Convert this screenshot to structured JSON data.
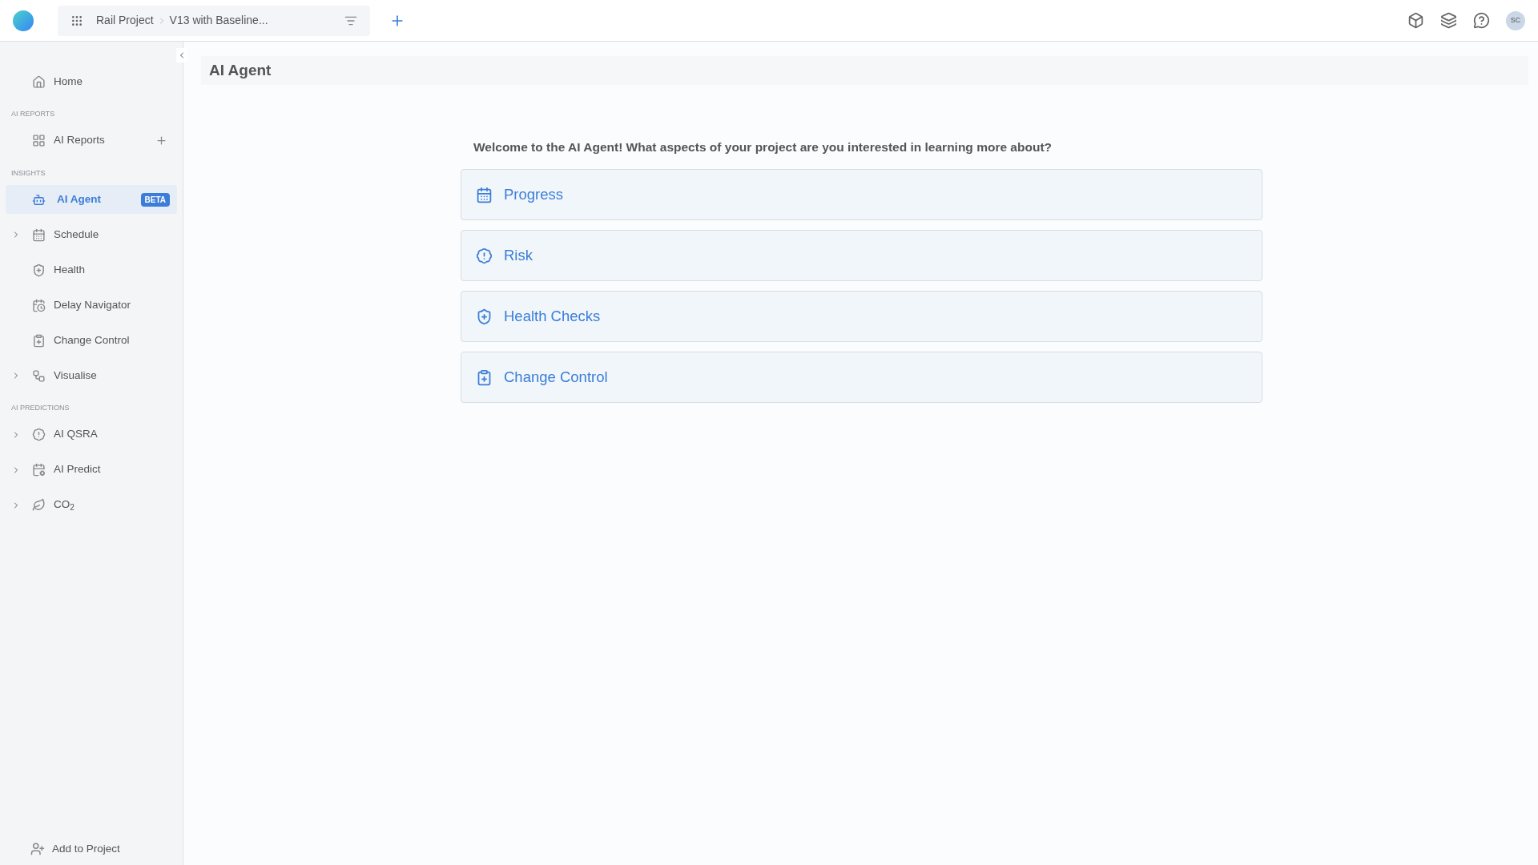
{
  "topbar": {
    "breadcrumb": [
      "Rail Project",
      "V13 with Baseline..."
    ],
    "avatar": "SC"
  },
  "sidebar": {
    "sections": [
      {
        "items": [
          {
            "label": "Home",
            "expandable": false,
            "selected": false
          }
        ]
      },
      {
        "heading": "AI REPORTS",
        "items": [
          {
            "label": "AI Reports",
            "expandable": false,
            "selected": false,
            "addable": true
          }
        ]
      },
      {
        "heading": "INSIGHTS",
        "items": [
          {
            "label": "AI Agent",
            "expandable": false,
            "selected": true,
            "badge": "BETA"
          },
          {
            "label": "Schedule",
            "expandable": true,
            "selected": false
          },
          {
            "label": "Health",
            "expandable": false,
            "selected": false
          },
          {
            "label": "Delay Navigator",
            "expandable": false,
            "selected": false
          },
          {
            "label": "Change Control",
            "expandable": false,
            "selected": false
          },
          {
            "label": "Visualise",
            "expandable": true,
            "selected": false
          }
        ]
      },
      {
        "heading": "AI PREDICTIONS",
        "items": [
          {
            "label": "AI QSRA",
            "expandable": true,
            "selected": false
          },
          {
            "label": "AI Predict",
            "expandable": true,
            "selected": false
          },
          {
            "label": "CO$_{2}$",
            "expandable": true,
            "selected": false
          }
        ]
      }
    ],
    "footer": "Add to Project"
  },
  "main": {
    "title": "AI Agent",
    "welcome": "Welcome to the AI Agent! What aspects of your project are you interested in learning more about?",
    "options": [
      {
        "label": "Progress"
      },
      {
        "label": "Risk"
      },
      {
        "label": "Health Checks"
      },
      {
        "label": "Change Control"
      }
    ]
  }
}
